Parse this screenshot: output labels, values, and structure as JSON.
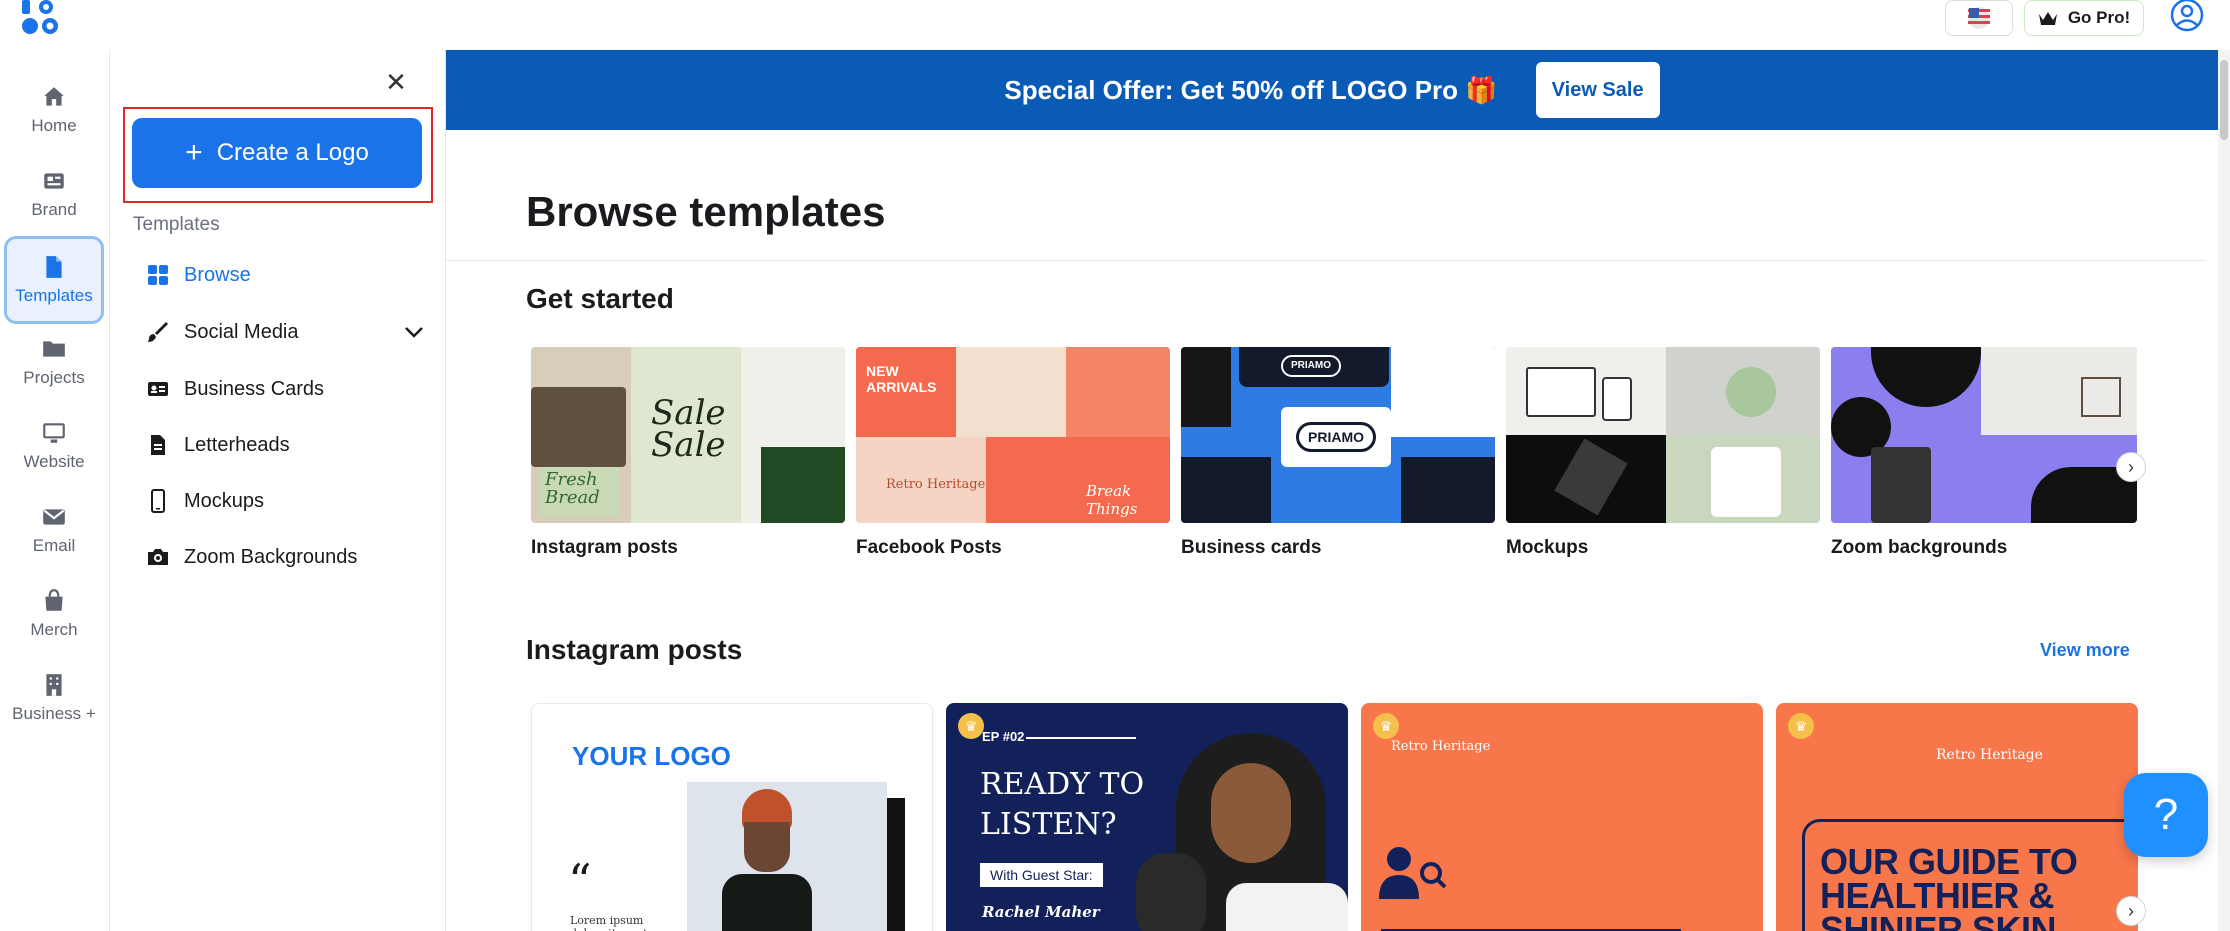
{
  "topbar": {
    "logo_text": "LO GO",
    "gopro_label": "Go Pro!"
  },
  "rail": [
    {
      "label": "Home",
      "icon": "home-icon"
    },
    {
      "label": "Brand",
      "icon": "brand-icon"
    },
    {
      "label": "Templates",
      "icon": "document-icon",
      "active": true
    },
    {
      "label": "Projects",
      "icon": "folder-icon"
    },
    {
      "label": "Website",
      "icon": "monitor-icon"
    },
    {
      "label": "Email",
      "icon": "envelope-icon"
    },
    {
      "label": "Merch",
      "icon": "shopping-bag-icon"
    },
    {
      "label": "Business +",
      "icon": "building-icon"
    }
  ],
  "sidebar": {
    "create_label": "Create a Logo",
    "section_label": "Templates",
    "items": [
      {
        "label": "Browse",
        "icon": "grid-icon",
        "active": true
      },
      {
        "label": "Social Media",
        "icon": "brush-icon"
      },
      {
        "label": "Business Cards",
        "icon": "id-card-icon"
      },
      {
        "label": "Letterheads",
        "icon": "file-icon"
      },
      {
        "label": "Mockups",
        "icon": "phone-icon"
      },
      {
        "label": "Zoom Backgrounds",
        "icon": "camera-icon"
      }
    ]
  },
  "banner": {
    "text": "Special Offer: Get 50% off LOGO Pro 🎁",
    "button": "View Sale"
  },
  "main": {
    "title": "Browse templates",
    "get_started": "Get started",
    "get_started_cards": [
      "Instagram posts",
      "Facebook Posts",
      "Business cards",
      "Mockups",
      "Zoom backgrounds"
    ],
    "instagram_title": "Instagram posts",
    "view_more": "View more",
    "ig_cards": [
      {
        "headline": "YOUR LOGO",
        "body": "Lorem ipsum dolor sit amet"
      },
      {
        "tag": "EP #02",
        "headline": "READY TO LISTEN?",
        "sub": "With Guest Star:",
        "name": "Rachel Maher"
      },
      {
        "brand": "Retro Heritage"
      },
      {
        "brand": "Retro Heritage",
        "headline": "OUR GUIDE TO HEALTHIER & SHINIER SKIN"
      }
    ]
  },
  "colors": {
    "accent": "#1a73e8",
    "banner": "#0a5bb6",
    "coral": "#f7764a",
    "navy": "#13215a",
    "highlight": "#e0262a"
  }
}
